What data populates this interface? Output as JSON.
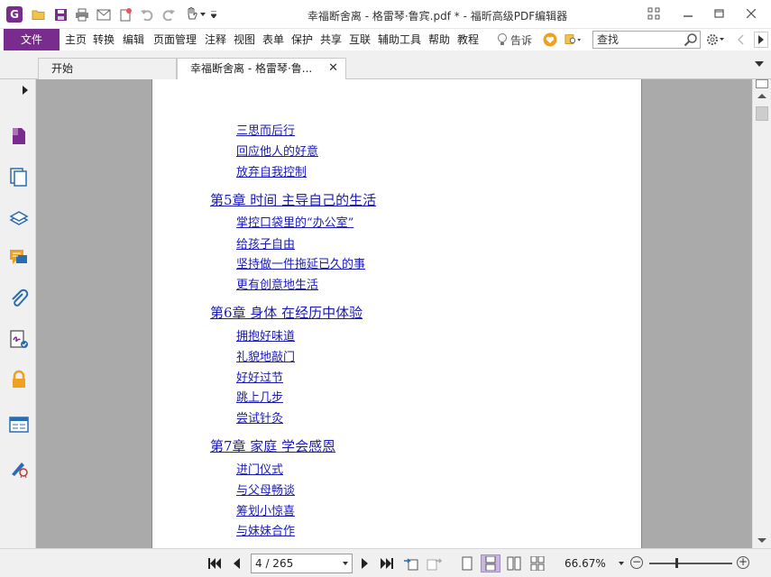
{
  "window": {
    "title": "幸福断舍离 - 格雷琴·鲁宾.pdf * - 福昕高级PDF编辑器",
    "app_logo_letter": "G"
  },
  "colors": {
    "accent": "#7a2c8e",
    "link": "#1a1ab8",
    "doc_bg": "#aaaaaa"
  },
  "menu": {
    "file": "文件",
    "items": [
      "主页",
      "转换",
      "编辑",
      "页面管理",
      "注释",
      "视图",
      "表单",
      "保护",
      "共享",
      "互联",
      "辅助工具",
      "帮助",
      "教程"
    ],
    "tell_me": "告诉",
    "search_placeholder": "查找"
  },
  "tabs": [
    {
      "label": "开始"
    },
    {
      "label": "幸福断舍离 - 格雷琴·鲁..."
    }
  ],
  "toc": [
    {
      "kind": "sub",
      "text": "三思而后行"
    },
    {
      "kind": "sub",
      "text": "回应他人的好意"
    },
    {
      "kind": "sub",
      "text": "放弃自我控制"
    },
    {
      "kind": "chap",
      "text": "第5章 时间 主导自己的生活"
    },
    {
      "kind": "sub",
      "text": "掌控口袋里的“办公室”"
    },
    {
      "kind": "sub",
      "text": "给孩子自由"
    },
    {
      "kind": "sub",
      "text": "坚持做一件拖延已久的事"
    },
    {
      "kind": "sub",
      "text": "更有创意地生活"
    },
    {
      "kind": "chap",
      "text": "第6章 身体 在经历中体验"
    },
    {
      "kind": "sub",
      "text": "拥抱好味道"
    },
    {
      "kind": "sub",
      "text": "礼貌地敲门"
    },
    {
      "kind": "sub",
      "text": "好好过节"
    },
    {
      "kind": "sub",
      "text": "跳上几步"
    },
    {
      "kind": "sub",
      "text": "尝试针灸"
    },
    {
      "kind": "chap",
      "text": "第7章 家庭 学会感恩"
    },
    {
      "kind": "sub",
      "text": "进门仪式"
    },
    {
      "kind": "sub",
      "text": "与父母畅谈"
    },
    {
      "kind": "sub",
      "text": "筹划小惊喜"
    },
    {
      "kind": "sub",
      "text": "与妹妹合作"
    }
  ],
  "status": {
    "page_indicator": "4 / 265",
    "zoom": "66.67%",
    "zoom_minus": "−",
    "zoom_plus": "+"
  }
}
